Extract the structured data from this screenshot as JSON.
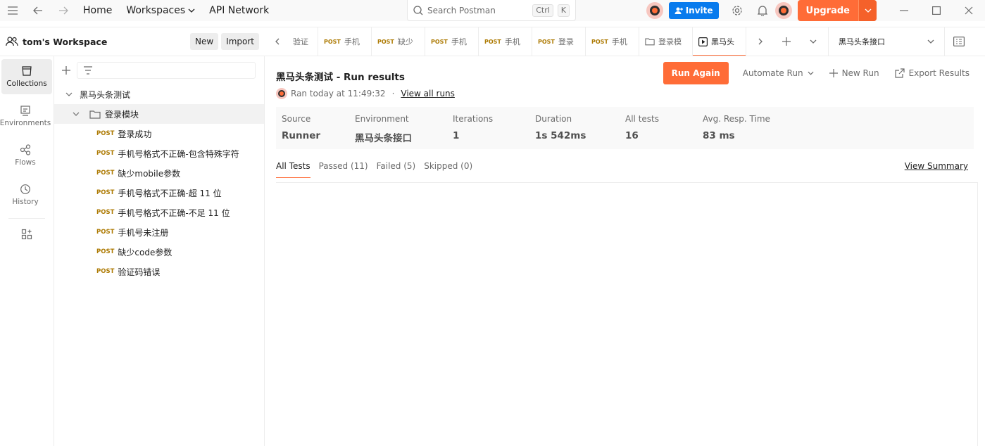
{
  "topbar": {
    "home": "Home",
    "workspaces": "Workspaces",
    "api_network": "API Network",
    "search_placeholder": "Search Postman",
    "kbd_ctrl": "Ctrl",
    "kbd_k": "K",
    "invite": "Invite",
    "upgrade": "Upgrade"
  },
  "workspace": {
    "name": "tom's Workspace",
    "new_label": "New",
    "import_label": "Import"
  },
  "rail": {
    "items": [
      {
        "label": "Collections",
        "icon": "collections-icon"
      },
      {
        "label": "Environments",
        "icon": "environments-icon"
      },
      {
        "label": "Flows",
        "icon": "flows-icon"
      },
      {
        "label": "History",
        "icon": "history-icon"
      }
    ]
  },
  "tree": {
    "collection": "黑马头条测试",
    "folder": "登录模块",
    "requests": [
      {
        "method": "POST",
        "name": "登录成功"
      },
      {
        "method": "POST",
        "name": "手机号格式不正确-包含特殊字符"
      },
      {
        "method": "POST",
        "name": "缺少mobile参数"
      },
      {
        "method": "POST",
        "name": "手机号格式不正确-超 11 位"
      },
      {
        "method": "POST",
        "name": "手机号格式不正确-不足 11 位"
      },
      {
        "method": "POST",
        "name": "手机号未注册"
      },
      {
        "method": "POST",
        "name": "缺少code参数"
      },
      {
        "method": "POST",
        "name": "验证码错误"
      }
    ]
  },
  "tabs": {
    "items": [
      {
        "method": "",
        "name": "验证"
      },
      {
        "method": "POST",
        "name": "手机"
      },
      {
        "method": "POST",
        "name": "缺少"
      },
      {
        "method": "POST",
        "name": "手机"
      },
      {
        "method": "POST",
        "name": "手机"
      },
      {
        "method": "POST",
        "name": "登录"
      },
      {
        "method": "POST",
        "name": "手机"
      }
    ],
    "folder_tab": "登录模",
    "runner_tab": "黑马头",
    "environment": "黑马头条接口"
  },
  "run": {
    "title": "黑马头条测试 - Run results",
    "ran_at": "Ran today at 11:49:32",
    "separator": "·",
    "view_all": "View all runs",
    "run_again": "Run Again",
    "automate": "Automate Run",
    "new_run": "New Run",
    "export": "Export Results"
  },
  "summary": {
    "columns": [
      {
        "header": "Source",
        "value": "Runner"
      },
      {
        "header": "Environment",
        "value": "黑马头条接口"
      },
      {
        "header": "Iterations",
        "value": "1"
      },
      {
        "header": "Duration",
        "value": "1s 542ms"
      },
      {
        "header": "All tests",
        "value": "16"
      },
      {
        "header": "Avg. Resp. Time",
        "value": "83 ms"
      }
    ]
  },
  "results": {
    "tabs": [
      "All Tests",
      "Passed (11)",
      "Failed (5)",
      "Skipped (0)"
    ],
    "view_summary": "View Summary"
  },
  "colors": {
    "accent": "#ff6c37",
    "invite": "#097bed",
    "method_post": "#ad7a03"
  }
}
